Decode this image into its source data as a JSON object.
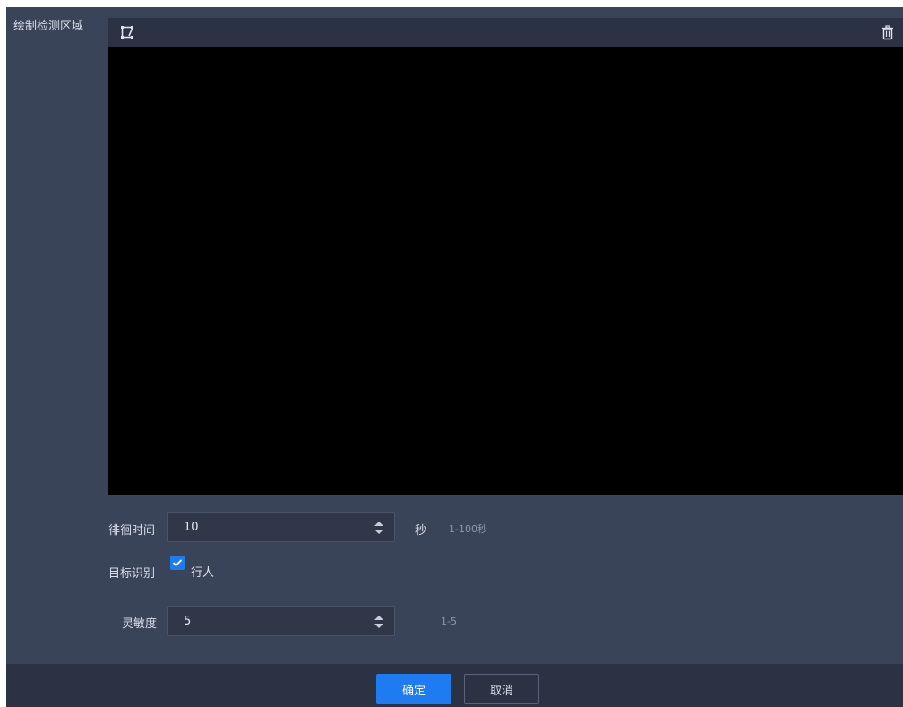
{
  "region": {
    "label": "绘制检测区域",
    "draw_icon": "draw-region-icon",
    "delete_icon": "trash-icon"
  },
  "loiter": {
    "label": "徘徊时间",
    "value": "10",
    "unit": "秒",
    "hint": "1-100秒"
  },
  "target": {
    "label": "目标识别",
    "option_label": "行人",
    "checked": true
  },
  "sensitivity": {
    "label": "灵敏度",
    "value": "5",
    "hint": "1-5"
  },
  "footer": {
    "ok_label": "确定",
    "cancel_label": "取消"
  },
  "colors": {
    "panel_bg": "#3a4459",
    "toolbar_bg": "#2b3244",
    "accent": "#1e7bf2",
    "video_bg": "#000000"
  }
}
